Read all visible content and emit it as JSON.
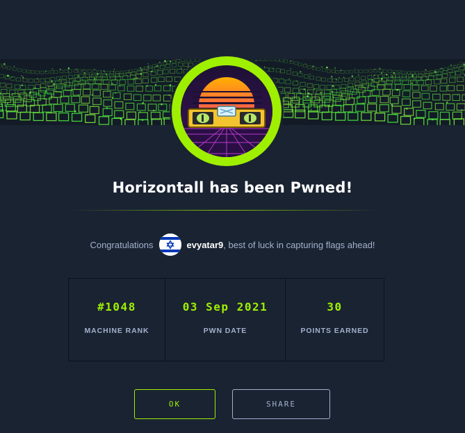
{
  "dialog": {
    "title": "Horizontall has been Pwned!",
    "congrats_prefix": "Congratulations",
    "username": "evyatar9",
    "congrats_suffix": ", best of luck in capturing flags ahead!",
    "avatar": "israel-flag-icon",
    "badge": "horizontall-machine-badge"
  },
  "stats": [
    {
      "value": "#1048",
      "label": "MACHINE RANK"
    },
    {
      "value": "03 Sep 2021",
      "label": "PWN DATE"
    },
    {
      "value": "30",
      "label": "POINTS EARNED"
    }
  ],
  "buttons": {
    "ok": "OK",
    "share": "SHARE"
  },
  "colors": {
    "background": "#1a2332",
    "accent": "#9fef00",
    "muted": "#a4b1cd",
    "title": "#ffffff"
  }
}
